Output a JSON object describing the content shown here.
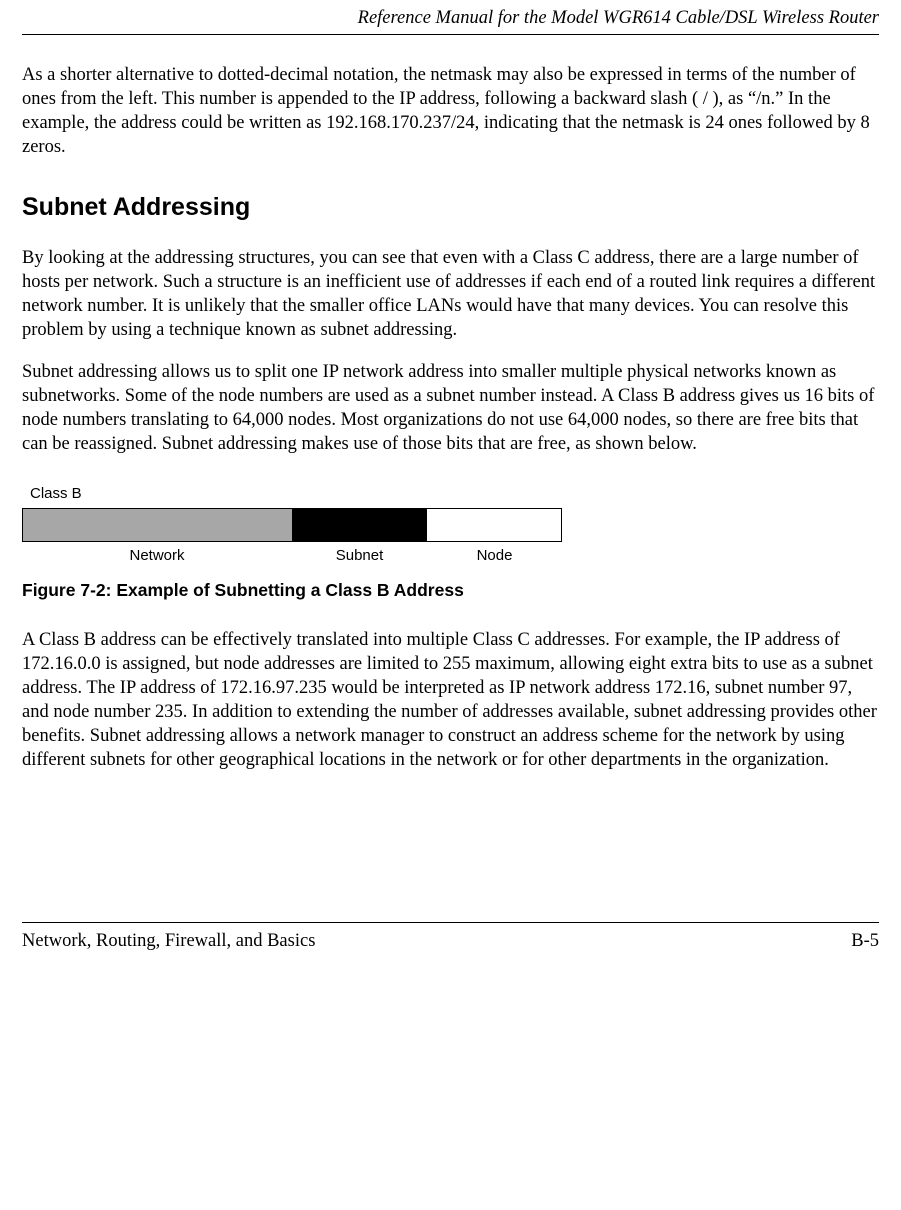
{
  "header": {
    "title": "Reference Manual for the Model WGR614 Cable/DSL Wireless Router"
  },
  "body": {
    "para1": "As a shorter alternative to dotted-decimal notation, the netmask may also be expressed in terms of the number of ones from the left. This number is appended to the IP address, following a backward slash ( / ), as “/n.” In the example, the address could be written as 192.168.170.237/24, indicating that the netmask is 24 ones followed by 8 zeros.",
    "heading1": "Subnet Addressing",
    "para2": "By looking at the addressing structures, you can see that even with a Class C address, there are a large number of hosts per network. Such a structure is an inefficient use of addresses if each end of a routed link requires a different network number. It is unlikely that the smaller office LANs would have that many devices. You can resolve this problem by using a technique known as subnet addressing.",
    "para3": "Subnet addressing allows us to split one IP network address into smaller multiple physical networks known as subnetworks. Some of the node numbers are used as a subnet number instead. A Class B address gives us 16 bits of node numbers translating to 64,000 nodes. Most organizations do not use 64,000 nodes, so there are free bits that can be reassigned. Subnet addressing makes use of those bits that are free, as shown below.",
    "figure": {
      "class_label": "Class B",
      "labels": {
        "network": "Network",
        "subnet": "Subnet",
        "node": "Node"
      },
      "caption": "Figure 7-2: Example of Subnetting a Class B Address"
    },
    "para4": "A Class B address can be effectively translated into multiple Class C addresses. For example, the IP address of 172.16.0.0 is assigned, but node addresses are limited to 255 maximum, allowing eight extra bits to use as a subnet address. The IP address of 172.16.97.235 would be interpreted as IP network address 172.16, subnet number 97, and node number 235. In addition to extending the number of addresses available, subnet addressing provides other benefits. Subnet addressing allows a network manager to construct an address scheme for the network by using different subnets for other geographical locations in the network or for other departments in the organization."
  },
  "footer": {
    "left": "Network, Routing, Firewall, and Basics",
    "right": "B-5"
  }
}
